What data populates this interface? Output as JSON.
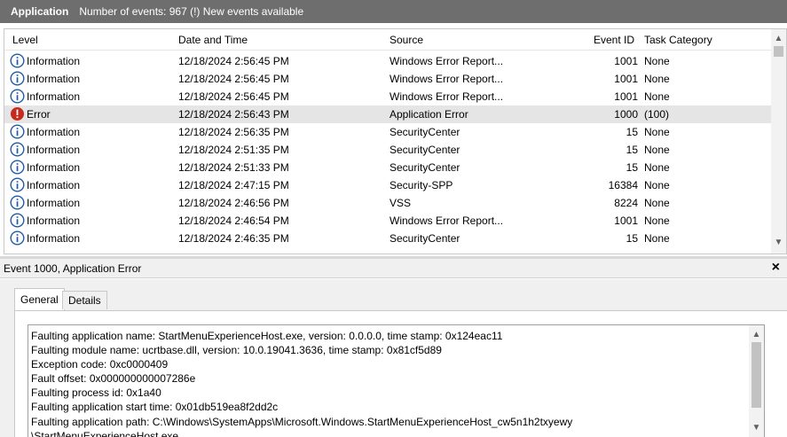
{
  "titlebar": {
    "log_name": "Application",
    "summary": "Number of events: 967 (!) New events available"
  },
  "columns": {
    "level": "Level",
    "datetime": "Date and Time",
    "source": "Source",
    "event_id": "Event ID",
    "task_category": "Task Category"
  },
  "events": [
    {
      "level": "Information",
      "level_icon": "info-icon",
      "datetime": "12/18/2024 2:56:45 PM",
      "source": "Windows Error Report...",
      "event_id": "1001",
      "task_category": "None"
    },
    {
      "level": "Information",
      "level_icon": "info-icon",
      "datetime": "12/18/2024 2:56:45 PM",
      "source": "Windows Error Report...",
      "event_id": "1001",
      "task_category": "None"
    },
    {
      "level": "Information",
      "level_icon": "info-icon",
      "datetime": "12/18/2024 2:56:45 PM",
      "source": "Windows Error Report...",
      "event_id": "1001",
      "task_category": "None"
    },
    {
      "level": "Error",
      "level_icon": "error-icon",
      "datetime": "12/18/2024 2:56:43 PM",
      "source": "Application Error",
      "event_id": "1000",
      "task_category": "(100)",
      "selected": true
    },
    {
      "level": "Information",
      "level_icon": "info-icon",
      "datetime": "12/18/2024 2:56:35 PM",
      "source": "SecurityCenter",
      "event_id": "15",
      "task_category": "None"
    },
    {
      "level": "Information",
      "level_icon": "info-icon",
      "datetime": "12/18/2024 2:51:35 PM",
      "source": "SecurityCenter",
      "event_id": "15",
      "task_category": "None"
    },
    {
      "level": "Information",
      "level_icon": "info-icon",
      "datetime": "12/18/2024 2:51:33 PM",
      "source": "SecurityCenter",
      "event_id": "15",
      "task_category": "None"
    },
    {
      "level": "Information",
      "level_icon": "info-icon",
      "datetime": "12/18/2024 2:47:15 PM",
      "source": "Security-SPP",
      "event_id": "16384",
      "task_category": "None"
    },
    {
      "level": "Information",
      "level_icon": "info-icon",
      "datetime": "12/18/2024 2:46:56 PM",
      "source": "VSS",
      "event_id": "8224",
      "task_category": "None"
    },
    {
      "level": "Information",
      "level_icon": "info-icon",
      "datetime": "12/18/2024 2:46:54 PM",
      "source": "Windows Error Report...",
      "event_id": "1001",
      "task_category": "None"
    },
    {
      "level": "Information",
      "level_icon": "info-icon",
      "datetime": "12/18/2024 2:46:35 PM",
      "source": "SecurityCenter",
      "event_id": "15",
      "task_category": "None"
    }
  ],
  "detail": {
    "title": "Event 1000, Application Error",
    "close_glyph": "×",
    "tabs": {
      "general": "General",
      "details": "Details"
    },
    "message_lines": [
      "Faulting application name: StartMenuExperienceHost.exe, version: 0.0.0.0, time stamp: 0x124eac11",
      "Faulting module name: ucrtbase.dll, version: 10.0.19041.3636, time stamp: 0x81cf5d89",
      "Exception code: 0xc0000409",
      "Fault offset: 0x000000000007286e",
      "Faulting process id: 0x1a40",
      "Faulting application start time: 0x01db519ea8f2dd2c",
      "Faulting application path: C:\\Windows\\SystemApps\\Microsoft.Windows.StartMenuExperienceHost_cw5n1h2txyewy",
      "\\StartMenuExperienceHost.exe"
    ]
  },
  "colors": {
    "titlebar_bg": "#6e6e6e",
    "info_icon": "#1f5aa6",
    "error_icon": "#c42b1c",
    "selected_row": "#e5e5e5"
  }
}
